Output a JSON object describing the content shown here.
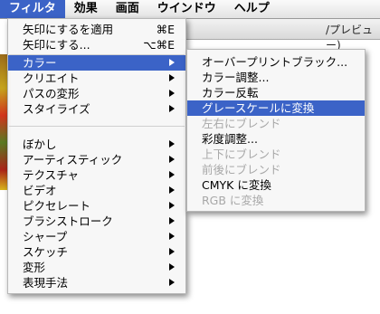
{
  "menubar": {
    "items": [
      {
        "label": "フィルタ"
      },
      {
        "label": "効果"
      },
      {
        "label": "画面"
      },
      {
        "label": "ウインドウ"
      },
      {
        "label": "ヘルプ"
      }
    ]
  },
  "background_window": {
    "title_fragment": "/プレビュー)"
  },
  "filter_menu": {
    "items": [
      {
        "label": "矢印にするを適用",
        "shortcut": "⌘E"
      },
      {
        "label": "矢印にする...",
        "shortcut": "⌥⌘E"
      },
      {
        "label": "カラー"
      },
      {
        "label": "クリエイト"
      },
      {
        "label": "パスの変形"
      },
      {
        "label": "スタイライズ"
      },
      {
        "label": "ぼかし"
      },
      {
        "label": "アーティスティック"
      },
      {
        "label": "テクスチャ"
      },
      {
        "label": "ビデオ"
      },
      {
        "label": "ピクセレート"
      },
      {
        "label": "ブラシストローク"
      },
      {
        "label": "シャープ"
      },
      {
        "label": "スケッチ"
      },
      {
        "label": "変形"
      },
      {
        "label": "表現手法"
      }
    ]
  },
  "color_submenu": {
    "items": [
      {
        "label": "オーバープリントブラック..."
      },
      {
        "label": "カラー調整..."
      },
      {
        "label": "カラー反転"
      },
      {
        "label": "グレースケールに変換"
      },
      {
        "label": "左右にブレンド"
      },
      {
        "label": "彩度調整..."
      },
      {
        "label": "上下にブレンド"
      },
      {
        "label": "前後にブレンド"
      },
      {
        "label": "CMYK に変換"
      },
      {
        "label": "RGB に変換"
      }
    ]
  },
  "colors": {
    "highlight": "#3b63c7",
    "disabled_text": "#a8a8a8"
  }
}
